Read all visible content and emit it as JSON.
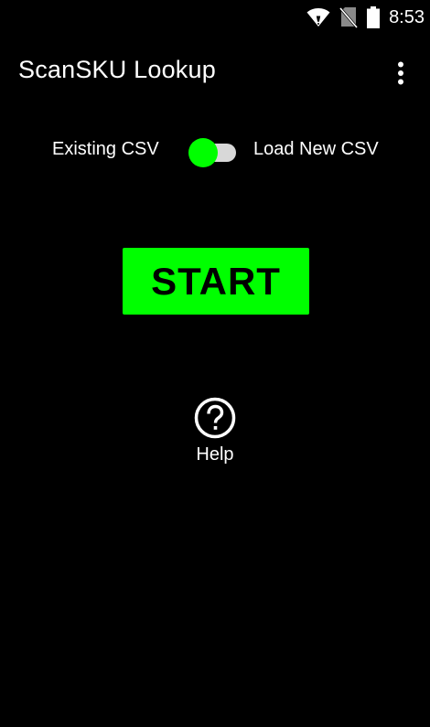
{
  "status_bar": {
    "time": "8:53",
    "icons": [
      "wifi-icon",
      "no-sim-icon",
      "battery-icon"
    ]
  },
  "app_bar": {
    "title": "ScanSKU Lookup",
    "menu_icon": "more-vert-icon"
  },
  "toggle": {
    "left_label": "Existing CSV",
    "right_label": "Load New CSV",
    "thumb_color": "#00ff00",
    "track_color": "#d8d8d8"
  },
  "start_button": {
    "label": "START",
    "color": "#00ff00"
  },
  "help": {
    "icon": "help-circle-icon",
    "label": "Help"
  },
  "colors": {
    "background": "#000000",
    "accent": "#00ff00",
    "text": "#ffffff"
  }
}
